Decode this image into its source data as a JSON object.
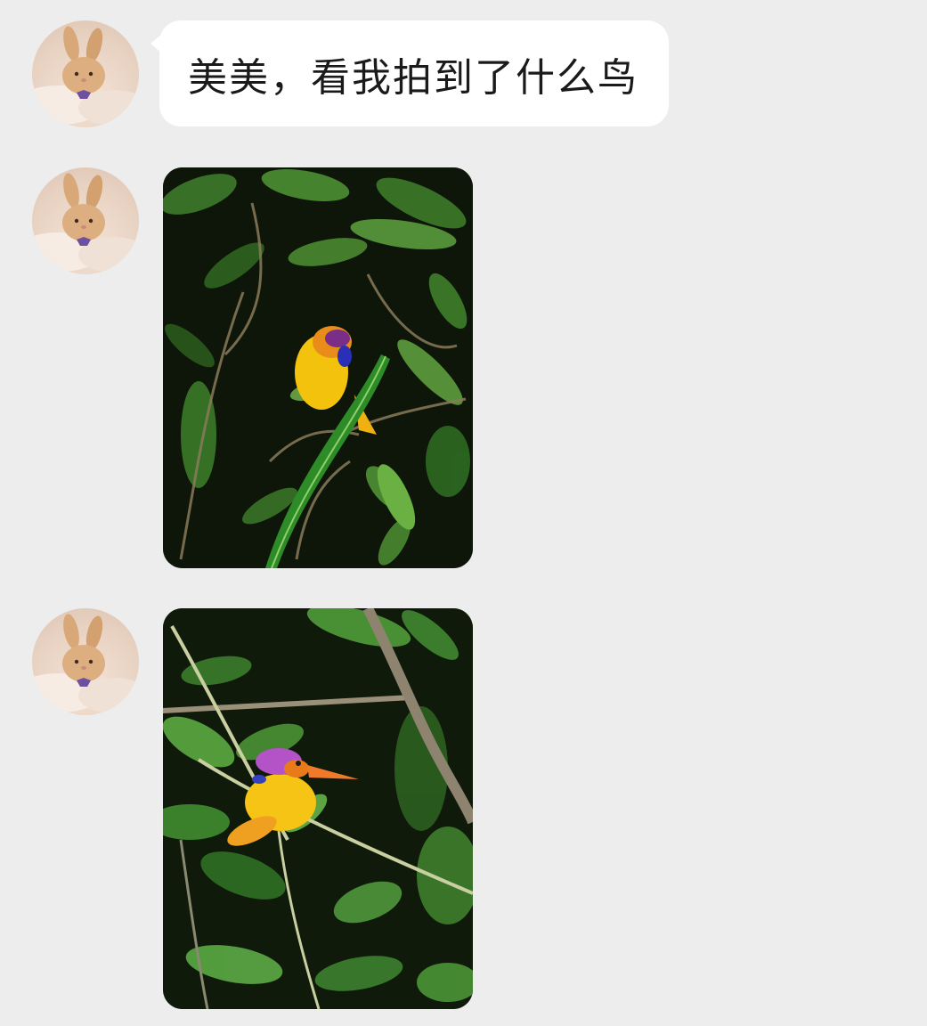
{
  "chat": {
    "messages": [
      {
        "type": "text",
        "sender_avatar": "plush-bunny-avatar",
        "text": "美美，看我拍到了什么鸟"
      },
      {
        "type": "image",
        "sender_avatar": "plush-bunny-avatar",
        "image": "kingfisher-photo-behind-leaf"
      },
      {
        "type": "image",
        "sender_avatar": "plush-bunny-avatar",
        "image": "kingfisher-photo-on-branch"
      }
    ]
  },
  "colors": {
    "background": "#ededed",
    "bubble": "#ffffff",
    "text": "#1a1a1a"
  }
}
